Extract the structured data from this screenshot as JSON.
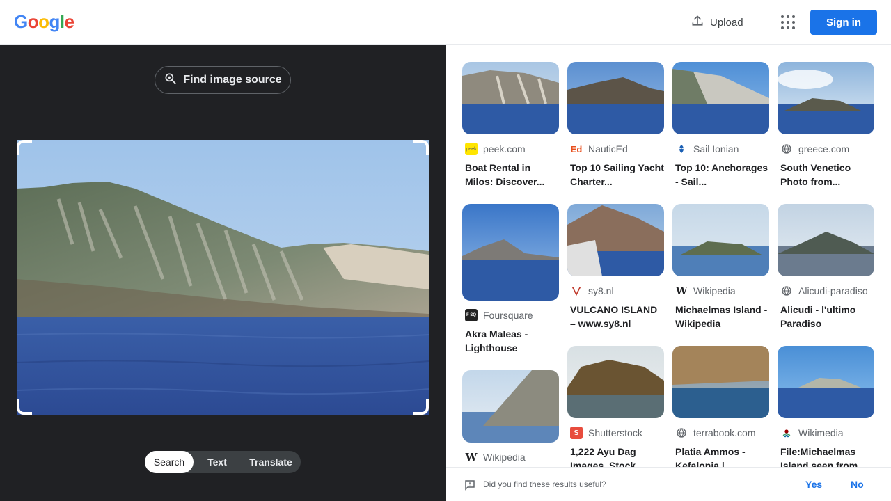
{
  "header": {
    "logo_letters": [
      {
        "ch": "G",
        "color": "#4285F4"
      },
      {
        "ch": "o",
        "color": "#EA4335"
      },
      {
        "ch": "o",
        "color": "#FBBC05"
      },
      {
        "ch": "g",
        "color": "#4285F4"
      },
      {
        "ch": "l",
        "color": "#34A853"
      },
      {
        "ch": "e",
        "color": "#EA4335"
      }
    ],
    "upload_label": "Upload",
    "signin_label": "Sign in"
  },
  "query_panel": {
    "find_source_label": "Find image source",
    "modes": [
      "Search",
      "Text",
      "Translate"
    ],
    "active_mode": "Search"
  },
  "results": [
    {
      "source": "peek.com",
      "favicon": "peek",
      "fav_color": "#FFE500",
      "fav_text_color": "#555",
      "title": "Boat Rental in Milos: Discover...",
      "scene": "cliffs"
    },
    {
      "source": "NauticEd",
      "favicon": "Ed",
      "fav_color": "#fff",
      "fav_text_color": "#E8501E",
      "title": "Top 10 Sailing Yacht Charter...",
      "scene": "volcano"
    },
    {
      "source": "Sail Ionian",
      "favicon": "S",
      "fav_color": "#fff",
      "fav_text_color": "#1a5fb4",
      "title": "Top 10: Anchorages - Sail...",
      "scene": "whitecliff"
    },
    {
      "source": "greece.com",
      "favicon": "globe",
      "fav_color": "#fff",
      "fav_text_color": "#5f6368",
      "title": "South Venetico Photo from...",
      "scene": "islet-cloud"
    },
    {
      "source": "Foursquare",
      "favicon": "F SQ",
      "fav_color": "#222",
      "fav_text_color": "#fff",
      "title": "Akra Maleas - Lighthouse",
      "scene": "waves"
    },
    {
      "source": "sy8.nl",
      "favicon": "sy8",
      "fav_color": "#fff",
      "fav_text_color": "#c0392b",
      "title": "VULCANO ISLAND – www.sy8.nl",
      "scene": "vulcano"
    },
    {
      "source": "Wikipedia",
      "favicon": "W",
      "fav_color": "#fff",
      "fav_text_color": "#202124",
      "title": "Michaelmas Island - Wikipedia",
      "scene": "flatislet"
    },
    {
      "source": "Alicudi-paradiso",
      "favicon": "globe",
      "fav_color": "#fff",
      "fav_text_color": "#5f6368",
      "title": "Alicudi - l'ultimo Paradiso",
      "scene": "cone"
    },
    {
      "source": "Wikipedia",
      "favicon": "W",
      "fav_color": "#fff",
      "fav_text_color": "#202124",
      "title": "",
      "scene": "rockyslope"
    },
    {
      "source": "Shutterstock",
      "favicon": "S",
      "fav_color": "#E84C3D",
      "fav_text_color": "#fff",
      "title": "1,222 Ayu Dag Images, Stock...",
      "scene": "ayudag"
    },
    {
      "source": "terrabook.com",
      "favicon": "globe",
      "fav_color": "#fff",
      "fav_text_color": "#5f6368",
      "title": "Platia Ammos - Kefalonia |...",
      "scene": "goldcliff"
    },
    {
      "source": "Wikimedia",
      "favicon": "wm",
      "fav_color": "#fff",
      "fav_text_color": "#339966",
      "title": "File:Michaelmas Island seen from...",
      "scene": "bluesea"
    }
  ],
  "feedback": {
    "question": "Did you find these results useful?",
    "yes": "Yes",
    "no": "No"
  }
}
